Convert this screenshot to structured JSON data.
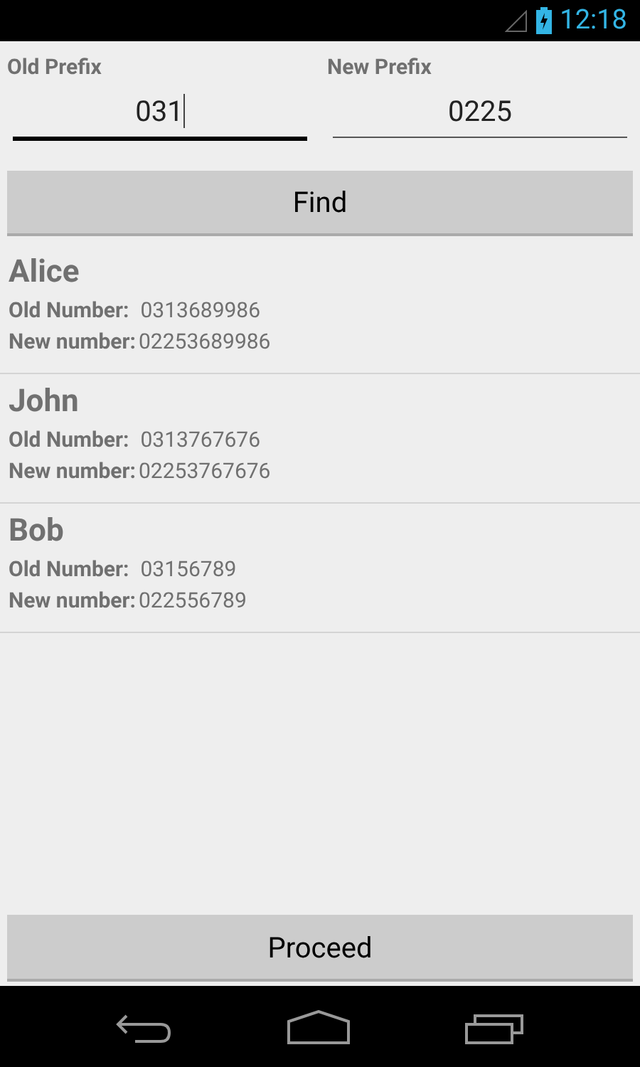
{
  "status_bar": {
    "time": "12:18"
  },
  "fields": [
    {
      "label": "Old Prefix",
      "value": "031",
      "focused": true
    },
    {
      "label": "New Prefix",
      "value": "0225",
      "focused": false
    }
  ],
  "find_button": "Find",
  "contacts": [
    {
      "name": "Alice",
      "old_label": "Old Number:",
      "old_number": "0313689986",
      "new_label": "New number:",
      "new_number": "02253689986"
    },
    {
      "name": "John",
      "old_label": "Old Number:",
      "old_number": "0313767676",
      "new_label": "New number:",
      "new_number": "02253767676"
    },
    {
      "name": "Bob",
      "old_label": "Old Number:",
      "old_number": "03156789",
      "new_label": "New number:",
      "new_number": "022556789"
    }
  ],
  "proceed_button": "Proceed"
}
